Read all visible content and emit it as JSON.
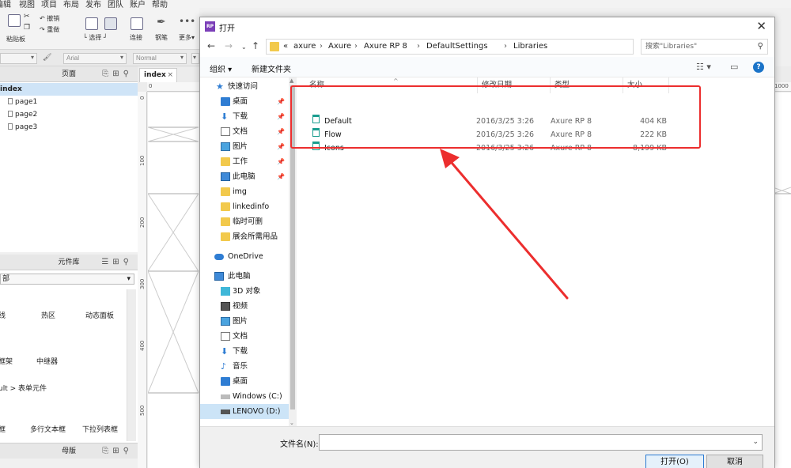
{
  "app": {
    "menu": [
      "编辑",
      "视图",
      "项目",
      "布局",
      "发布",
      "团队",
      "账户",
      "帮助"
    ],
    "toolbar": {
      "clipboard_label": "粘贴板",
      "undo_label": "撤销",
      "redo_label": "重做",
      "select_label": "选择",
      "connect_label": "连接",
      "pen_label": "钢笔",
      "more_label": "更多▾"
    },
    "format": {
      "font": "Arial",
      "style": "Normal"
    },
    "pages_panel": {
      "title": "页面",
      "items": [
        {
          "label": "index",
          "selected": true
        },
        {
          "label": "page1"
        },
        {
          "label": "page2"
        },
        {
          "label": "page3"
        }
      ]
    },
    "widgets_panel": {
      "title": "元件库",
      "library": "部",
      "row1": [
        "线",
        "热区",
        "动态面板"
      ],
      "row2": [
        "框架",
        "中继器"
      ],
      "section": "ult > 表单元件",
      "row3": [
        "框",
        "多行文本框",
        "下拉列表框"
      ]
    },
    "masters_panel": {
      "title": "母版"
    },
    "canvas": {
      "tab": "index",
      "ruler_top": [
        "0",
        "1000"
      ],
      "ruler_left": [
        "0",
        "100",
        "200",
        "300",
        "400",
        "500"
      ]
    }
  },
  "dialog": {
    "title": "打开",
    "breadcrumb": [
      "«",
      "axure",
      "Axure",
      "Axure RP 8",
      "DefaultSettings",
      "Libraries"
    ],
    "search_placeholder": "搜索\"Libraries\"",
    "organize": "组织 ▾",
    "new_folder": "新建文件夹",
    "nav": [
      {
        "label": "快速访问",
        "icon": "star-icon"
      },
      {
        "label": "桌面",
        "icon": "desktop-icon",
        "pinned": true
      },
      {
        "label": "下载",
        "icon": "download-icon",
        "pinned": true
      },
      {
        "label": "文档",
        "icon": "documents-icon",
        "pinned": true
      },
      {
        "label": "图片",
        "icon": "pictures-icon",
        "pinned": true
      },
      {
        "label": "工作",
        "icon": "folder-icon",
        "pinned": true
      },
      {
        "label": "此电脑",
        "icon": "computer-icon",
        "pinned": true
      },
      {
        "label": "img",
        "icon": "folder-icon"
      },
      {
        "label": "linkedinfo",
        "icon": "folder-icon"
      },
      {
        "label": "临时可删",
        "icon": "folder-icon"
      },
      {
        "label": "展会所需用品",
        "icon": "folder-icon"
      },
      {
        "label": "OneDrive",
        "icon": "onedrive-icon"
      },
      {
        "label": "此电脑",
        "icon": "computer-icon"
      },
      {
        "label": "3D 对象",
        "icon": "3d-objects-icon"
      },
      {
        "label": "视频",
        "icon": "video-icon"
      },
      {
        "label": "图片",
        "icon": "pictures-icon"
      },
      {
        "label": "文档",
        "icon": "documents-icon"
      },
      {
        "label": "下载",
        "icon": "download-icon"
      },
      {
        "label": "音乐",
        "icon": "music-icon"
      },
      {
        "label": "桌面",
        "icon": "desktop-icon"
      },
      {
        "label": "Windows (C:)",
        "icon": "drive-icon"
      },
      {
        "label": "LENOVO (D:)",
        "icon": "drive-icon",
        "selected": true
      }
    ],
    "columns": {
      "name": "名称",
      "date": "修改日期",
      "type": "类型",
      "size": "大小"
    },
    "files": [
      {
        "name": "Default",
        "date": "2016/3/25 3:26",
        "type": "Axure RP 8",
        "size": "404 KB"
      },
      {
        "name": "Flow",
        "date": "2016/3/25 3:26",
        "type": "Axure RP 8",
        "size": "222 KB"
      },
      {
        "name": "Icons",
        "date": "2016/3/25 3:26",
        "type": "Axure RP 8",
        "size": "8,199 KB"
      }
    ],
    "filename_label": "文件名(N):",
    "filename_value": "",
    "open_button": "打开(O)",
    "cancel_button": "取消"
  },
  "colors": {
    "highlight": "#ec2e2e",
    "selection": "#cce4f7",
    "accent": "#2a7ad2"
  }
}
